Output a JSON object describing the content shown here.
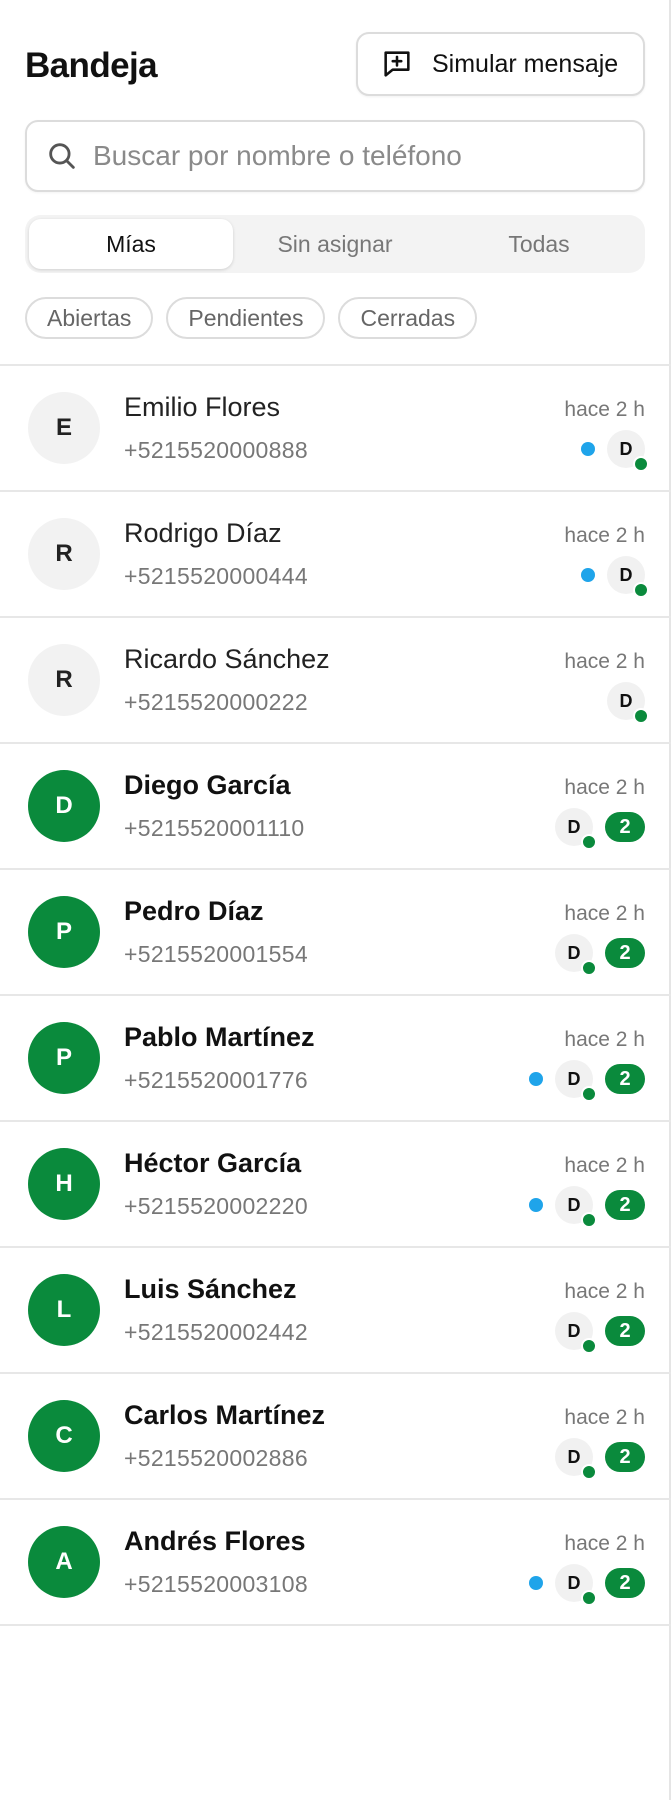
{
  "header": {
    "title": "Bandeja",
    "simulate_label": "Simular mensaje"
  },
  "search": {
    "placeholder": "Buscar por nombre o teléfono",
    "value": ""
  },
  "tabs": [
    {
      "label": "Mías",
      "active": true
    },
    {
      "label": "Sin asignar",
      "active": false
    },
    {
      "label": "Todas",
      "active": false
    }
  ],
  "filters": [
    {
      "label": "Abiertas"
    },
    {
      "label": "Pendientes"
    },
    {
      "label": "Cerradas"
    }
  ],
  "colors": {
    "accent_green": "#0a8a3c",
    "unread_dot_blue": "#1fa4ea"
  },
  "conversations": [
    {
      "initial": "E",
      "name": "Emilio Flores",
      "phone": "+5215520000888",
      "time": "hace 2 h",
      "unread": false,
      "blue_dot": true,
      "agent": "D",
      "count": null
    },
    {
      "initial": "R",
      "name": "Rodrigo Díaz",
      "phone": "+5215520000444",
      "time": "hace 2 h",
      "unread": false,
      "blue_dot": true,
      "agent": "D",
      "count": null
    },
    {
      "initial": "R",
      "name": "Ricardo Sánchez",
      "phone": "+5215520000222",
      "time": "hace 2 h",
      "unread": false,
      "blue_dot": false,
      "agent": "D",
      "count": null
    },
    {
      "initial": "D",
      "name": "Diego García",
      "phone": "+5215520001110",
      "time": "hace 2 h",
      "unread": true,
      "blue_dot": false,
      "agent": "D",
      "count": "2"
    },
    {
      "initial": "P",
      "name": "Pedro Díaz",
      "phone": "+5215520001554",
      "time": "hace 2 h",
      "unread": true,
      "blue_dot": false,
      "agent": "D",
      "count": "2"
    },
    {
      "initial": "P",
      "name": "Pablo Martínez",
      "phone": "+5215520001776",
      "time": "hace 2 h",
      "unread": true,
      "blue_dot": true,
      "agent": "D",
      "count": "2"
    },
    {
      "initial": "H",
      "name": "Héctor García",
      "phone": "+5215520002220",
      "time": "hace 2 h",
      "unread": true,
      "blue_dot": true,
      "agent": "D",
      "count": "2"
    },
    {
      "initial": "L",
      "name": "Luis Sánchez",
      "phone": "+5215520002442",
      "time": "hace 2 h",
      "unread": true,
      "blue_dot": false,
      "agent": "D",
      "count": "2"
    },
    {
      "initial": "C",
      "name": "Carlos Martínez",
      "phone": "+5215520002886",
      "time": "hace 2 h",
      "unread": true,
      "blue_dot": false,
      "agent": "D",
      "count": "2"
    },
    {
      "initial": "A",
      "name": "Andrés Flores",
      "phone": "+5215520003108",
      "time": "hace 2 h",
      "unread": true,
      "blue_dot": true,
      "agent": "D",
      "count": "2"
    }
  ]
}
